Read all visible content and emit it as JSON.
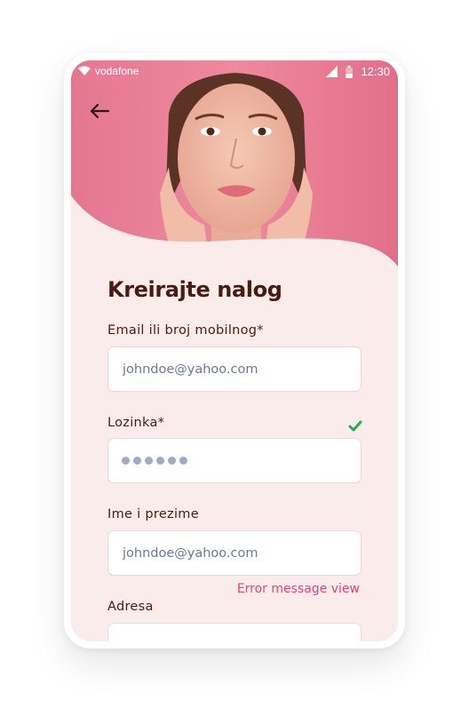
{
  "status_bar": {
    "carrier": "vodafone",
    "time": "12:30",
    "icons": [
      "wifi-icon",
      "signal-icon",
      "battery-icon"
    ]
  },
  "header": {
    "back_icon": "arrow-left-icon",
    "hero_image": "woman-portrait-photo"
  },
  "form": {
    "title": "Kreirajte nalog",
    "email": {
      "label": "Email ili broj mobilnog*",
      "placeholder": "johndoe@yahoo.com"
    },
    "password": {
      "label": "Lozinka*",
      "masked_length": 6,
      "valid_icon": "check-icon"
    },
    "name": {
      "label": "Ime i prezime",
      "placeholder": "johndoe@yahoo.com",
      "error": "Error message view"
    },
    "address": {
      "label": "Adresa",
      "placeholder": ""
    }
  },
  "colors": {
    "background": "#faeceb",
    "title": "#4a1c0f",
    "error": "#e0457d",
    "success": "#1fb24c",
    "hero_pink": "#e7768f"
  }
}
